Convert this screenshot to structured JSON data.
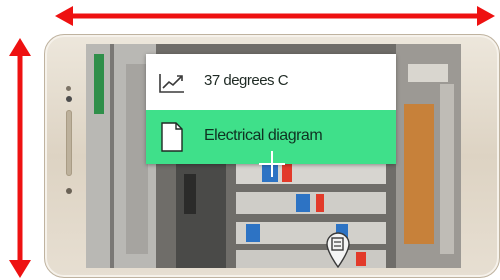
{
  "indicators": {
    "horizontal_arrow": "double-headed arrow",
    "vertical_arrow": "double-headed arrow",
    "color": "#ee1111"
  },
  "overlay_menu": {
    "items": [
      {
        "label": "37 degrees C",
        "icon": "trend-chart-icon",
        "background": "#ffffff"
      },
      {
        "label": "Electrical diagram",
        "icon": "document-icon",
        "background": "#3fe08a"
      }
    ]
  },
  "markers": {
    "target": "crosshair-icon",
    "pin": "map-pin-icon"
  }
}
